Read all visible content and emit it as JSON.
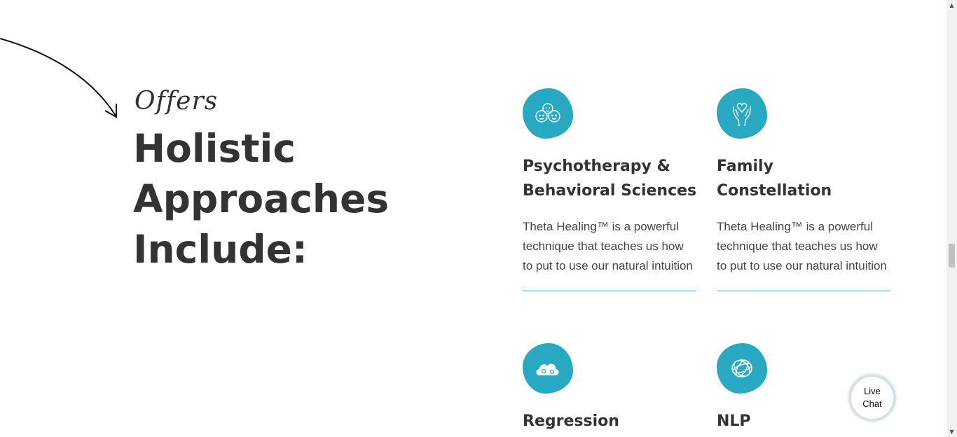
{
  "intro": {
    "script_label": "Offers",
    "headline": [
      "Holistic",
      "Approaches",
      "Include:"
    ]
  },
  "services": [
    {
      "title": "Psychotherapy & Behavioral Sciences",
      "description": "Theta Healing™ is a powerful technique that teaches us how to put to use our natural intuition",
      "icon": "three-faces-icon"
    },
    {
      "title": "Family Constellation",
      "description": "Theta Healing™ is a powerful technique that teaches us how to put to use our natural intuition",
      "icon": "heart-hands-icon"
    },
    {
      "title": "Regression",
      "icon": "cloud-icon"
    },
    {
      "title": "NLP",
      "icon": "sphere-knot-icon"
    }
  ],
  "live_chat": {
    "line1": "Live",
    "line2": "Chat"
  },
  "colors": {
    "accent": "#29a9c1",
    "text": "#333333"
  }
}
